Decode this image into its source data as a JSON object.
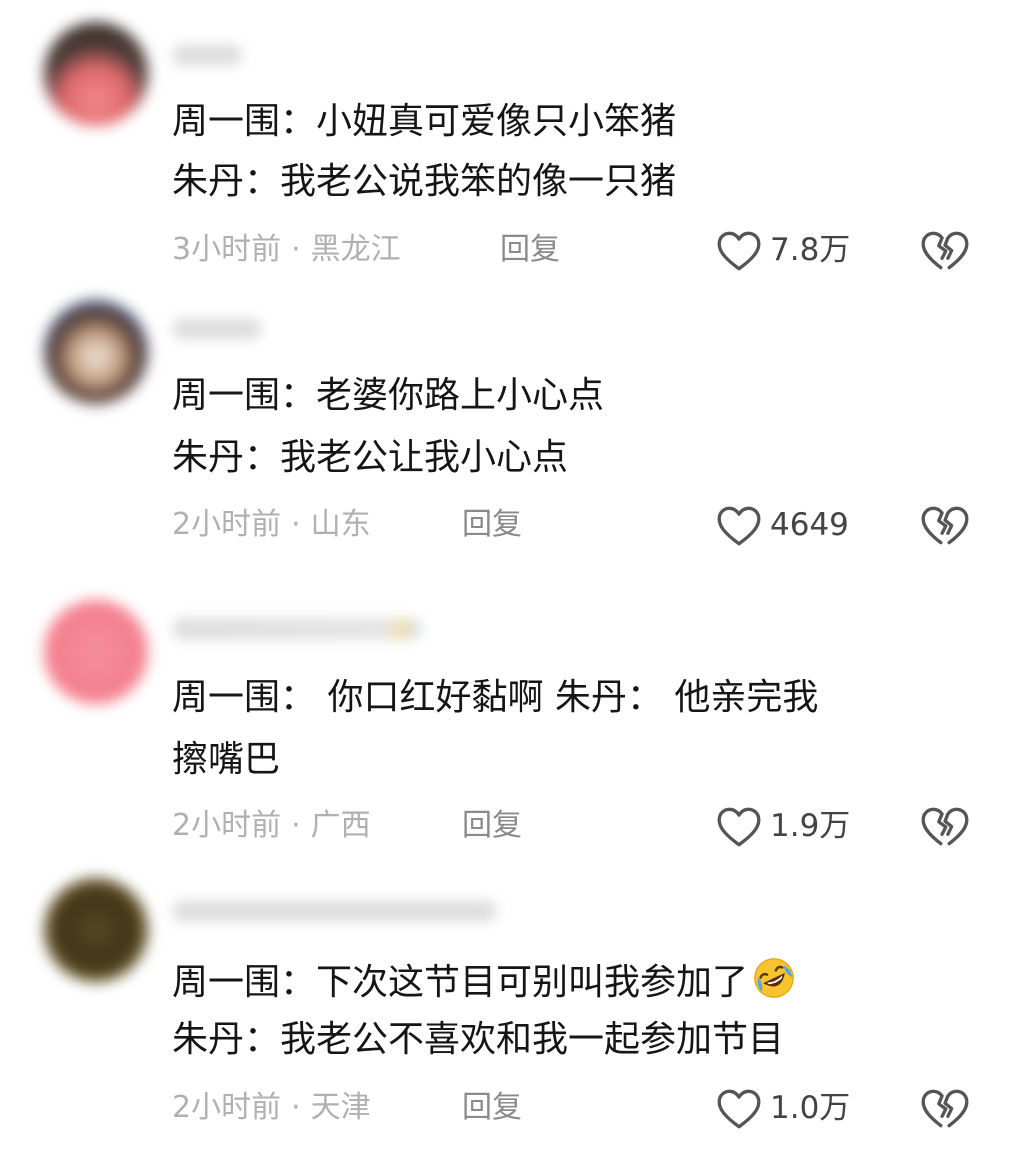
{
  "comments": [
    {
      "lines": [
        "周一围：小妞真可爱像只小笨猪",
        "朱丹：我老公说我笨的像一只猪"
      ],
      "time": "3小时前",
      "separator": "·",
      "location": "黑龙江",
      "reply_label": "回复",
      "likes": "7.8万"
    },
    {
      "lines": [
        "周一围：老婆你路上小心点",
        "朱丹：我老公让我小心点"
      ],
      "time": "2小时前",
      "separator": "·",
      "location": "山东",
      "reply_label": "回复",
      "likes": "4649"
    },
    {
      "lines": [
        "周一围： 你口红好黏啊  朱丹： 他亲完我",
        "擦嘴巴"
      ],
      "time": "2小时前",
      "separator": "·",
      "location": "广西",
      "reply_label": "回复",
      "likes": "1.9万"
    },
    {
      "lines": [
        "周一围：下次这节目可别叫我参加了",
        "朱丹：我老公不喜欢和我一起参加节目"
      ],
      "time": "2小时前",
      "separator": "·",
      "location": "天津",
      "reply_label": "回复",
      "likes": "1.0万"
    }
  ],
  "icons": {
    "like": "heart-outline-icon",
    "dislike": "broken-heart-icon",
    "emoji": "rolling-on-floor-laughing-emoji"
  },
  "colors": {
    "text": "#151515",
    "meta": "#b0b0b0",
    "reply": "#8a8a8a",
    "icon": "#555555"
  }
}
